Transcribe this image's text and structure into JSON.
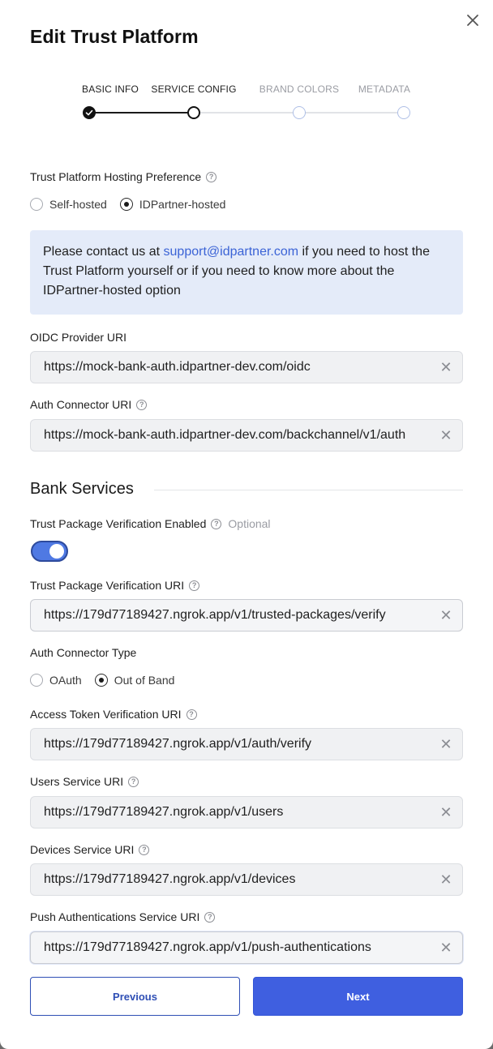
{
  "dialog": {
    "title": "Edit Trust Platform",
    "close_icon": "close-icon"
  },
  "stepper": {
    "steps": [
      {
        "label": "BASIC INFO",
        "state": "completed"
      },
      {
        "label": "SERVICE CONFIG",
        "state": "current"
      },
      {
        "label": "BRAND COLORS",
        "state": "upcoming"
      },
      {
        "label": "METADATA",
        "state": "upcoming"
      }
    ]
  },
  "hosting": {
    "label": "Trust Platform Hosting Preference",
    "options": [
      {
        "label": "Self-hosted",
        "selected": false
      },
      {
        "label": "IDPartner-hosted",
        "selected": true
      }
    ]
  },
  "info_box": {
    "text_before": "Please contact us at ",
    "link": "support@idpartner.com",
    "text_after": " if you need to host the Trust Platform yourself or if you need to know more about the IDPartner-hosted option"
  },
  "oidc": {
    "label": "OIDC Provider URI",
    "value": "https://mock-bank-auth.idpartner-dev.com/oidc"
  },
  "auth_connector": {
    "label": "Auth Connector URI",
    "value": "https://mock-bank-auth.idpartner-dev.com/backchannel/v1/auth"
  },
  "bank_services": {
    "heading": "Bank Services"
  },
  "trust_package_enabled": {
    "label": "Trust Package Verification Enabled",
    "optional": "Optional",
    "on": true
  },
  "trust_package_uri": {
    "label": "Trust Package Verification URI",
    "value": "https://179d77189427.ngrok.app/v1/trusted-packages/verify"
  },
  "auth_connector_type": {
    "label": "Auth Connector Type",
    "options": [
      {
        "label": "OAuth",
        "selected": false
      },
      {
        "label": "Out of Band",
        "selected": true
      }
    ]
  },
  "access_token": {
    "label": "Access Token Verification URI",
    "value": "https://179d77189427.ngrok.app/v1/auth/verify"
  },
  "users_service": {
    "label": "Users Service URI",
    "value": "https://179d77189427.ngrok.app/v1/users"
  },
  "devices_service": {
    "label": "Devices Service URI",
    "value": "https://179d77189427.ngrok.app/v1/devices"
  },
  "push_auth": {
    "label": "Push Authentications Service URI",
    "value": "https://179d77189427.ngrok.app/v1/push-authentications"
  },
  "footer": {
    "previous": "Previous",
    "next": "Next"
  },
  "colors": {
    "accent": "#3f5fe0",
    "info_bg": "#e4ebf9",
    "link": "#3b63d6",
    "muted": "#9a9ca3"
  }
}
